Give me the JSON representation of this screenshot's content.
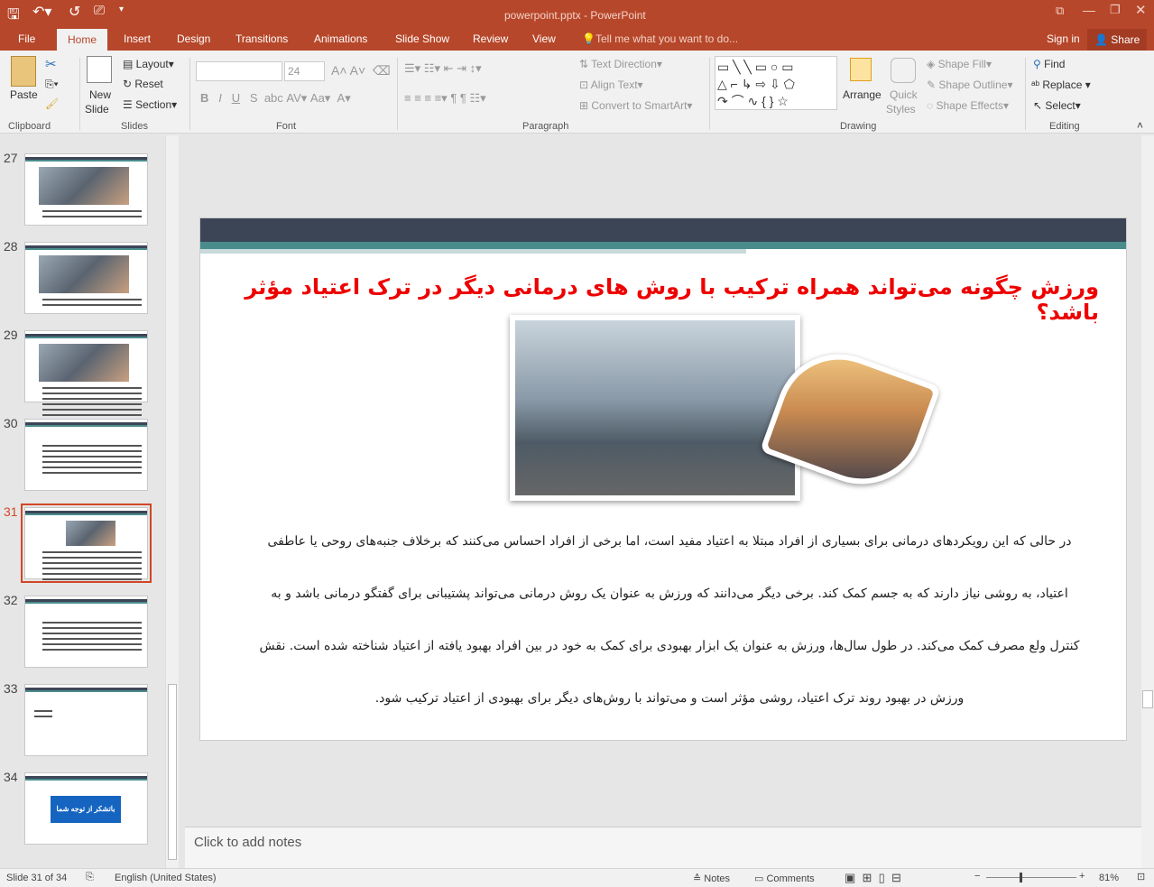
{
  "window": {
    "title": "powerpoint.pptx - PowerPoint",
    "sign_in": "Sign in",
    "share": "Share"
  },
  "tabs": [
    "File",
    "Home",
    "Insert",
    "Design",
    "Transitions",
    "Animations",
    "Slide Show",
    "Review",
    "View"
  ],
  "tell_me": "Tell me what you want to do...",
  "ribbon": {
    "clipboard": {
      "paste": "Paste",
      "label": "Clipboard"
    },
    "slides": {
      "new_slide": "New",
      "new_slide2": "Slide",
      "layout": "Layout",
      "reset": "Reset",
      "section": "Section",
      "label": "Slides"
    },
    "font": {
      "font_name": "",
      "font_size": "24",
      "label": "Font"
    },
    "paragraph": {
      "text_direction": "Text Direction",
      "align_text": "Align Text",
      "smartart": "Convert to SmartArt",
      "label": "Paragraph"
    },
    "drawing": {
      "arrange": "Arrange",
      "quick_styles": "Quick",
      "quick_styles2": "Styles",
      "shape_fill": "Shape Fill",
      "shape_outline": "Shape Outline",
      "shape_effects": "Shape Effects",
      "label": "Drawing"
    },
    "editing": {
      "find": "Find",
      "replace": "Replace",
      "select": "Select",
      "label": "Editing"
    }
  },
  "thumbnails": [
    {
      "num": "27"
    },
    {
      "num": "28"
    },
    {
      "num": "29"
    },
    {
      "num": "30"
    },
    {
      "num": "31",
      "selected": true
    },
    {
      "num": "32"
    },
    {
      "num": "33"
    },
    {
      "num": "34",
      "text": "باتشکر از توجه شما"
    }
  ],
  "slide": {
    "title": "ورزش چگونه می‌تواند همراه ترکیب با روش های درمانی دیگر در ترک اعتیاد مؤثر باشد؟",
    "body": [
      "در حالی که این رویکردهای درمانی برای بسیاری از افراد مبتلا به اعتیاد مفید است، اما برخی از افراد احساس می‌کنند که برخلاف جنبه‌های روحی یا عاطفی",
      "اعتیاد، به روشی نیاز دارند که به جسم کمک کند. برخی دیگر می‌دانند که ورزش به عنوان یک روش درمانی می‌تواند پشتیبانی برای گفتگو درمانی باشد و به",
      "کنترل ولع مصرف کمک می‌کند. در طول سال‌ها، ورزش به عنوان یک ابزار بهبودی برای کمک به خود در بین افراد بهبود یافته از اعتیاد شناخته شده است. نقش",
      "ورزش در بهبود روند ترک اعتیاد، روشی مؤثر است و می‌تواند با روش‌های دیگر برای بهبودی از اعتیاد ترکیب شود."
    ]
  },
  "notes": {
    "placeholder": "Click to add notes"
  },
  "status": {
    "slide": "Slide 31 of 34",
    "language": "English (United States)",
    "notes": "Notes",
    "comments": "Comments",
    "zoom": "81%"
  },
  "colors": {
    "accent": "#b7472a",
    "title_red": "#ee0000",
    "slide_header": "#3c4556",
    "teal": "#4a8c8c"
  }
}
